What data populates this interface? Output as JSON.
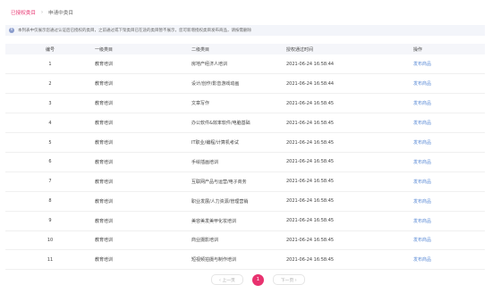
{
  "tabs": {
    "active": "已授权类目",
    "inactive": "申请中类目"
  },
  "notice": "本列表中仅展示您通过认证后已授权的类目，之前通过或下架类目已在途的类目暂不展示，您可新增授权类目发布商品，请按需删除",
  "table": {
    "headers": [
      "编号",
      "一级类目",
      "二级类目",
      "授权通过时间",
      "操作"
    ],
    "rows": [
      {
        "id": "1",
        "cat1": "教育培训",
        "cat2": "房地产经济人培训",
        "time": "2021-06-24 16:58:44",
        "action": "发布商品"
      },
      {
        "id": "2",
        "cat1": "教育培训",
        "cat2": "设计/创作/影音游戏动画",
        "time": "2021-06-24 16:58:44",
        "action": "发布商品"
      },
      {
        "id": "3",
        "cat1": "教育培训",
        "cat2": "文章写作",
        "time": "2021-06-24 16:58:45",
        "action": "发布商品"
      },
      {
        "id": "4",
        "cat1": "教育培训",
        "cat2": "办公软件&效率软件/电脑基础",
        "time": "2021-06-24 16:58:45",
        "action": "发布商品"
      },
      {
        "id": "5",
        "cat1": "教育培训",
        "cat2": "IT职业/编程/计算机考试",
        "time": "2021-06-24 16:58:45",
        "action": "发布商品"
      },
      {
        "id": "6",
        "cat1": "教育培训",
        "cat2": "手绘插画培训",
        "time": "2021-06-24 16:58:45",
        "action": "发布商品"
      },
      {
        "id": "7",
        "cat1": "教育培训",
        "cat2": "互联网产品与运营/电子商务",
        "time": "2021-06-24 16:58:45",
        "action": "发布商品"
      },
      {
        "id": "8",
        "cat1": "教育培训",
        "cat2": "职业发展/人力资源/管理营销",
        "time": "2021-06-24 16:58:45",
        "action": "发布商品"
      },
      {
        "id": "9",
        "cat1": "教育培训",
        "cat2": "美容美发美甲化妆培训",
        "time": "2021-06-24 16:58:45",
        "action": "发布商品"
      },
      {
        "id": "10",
        "cat1": "教育培训",
        "cat2": "商业摄影培训",
        "time": "2021-06-24 16:58:45",
        "action": "发布商品"
      },
      {
        "id": "11",
        "cat1": "教育培训",
        "cat2": "短视频拍摄与制作培训",
        "time": "2021-06-24 16:58:45",
        "action": "发布商品"
      }
    ]
  },
  "pagination": {
    "prev": "‹ 上一页",
    "current": "1",
    "next": "下一页 ›"
  },
  "colors": {
    "accent": "#e8326f",
    "link": "#5b8bd6"
  }
}
